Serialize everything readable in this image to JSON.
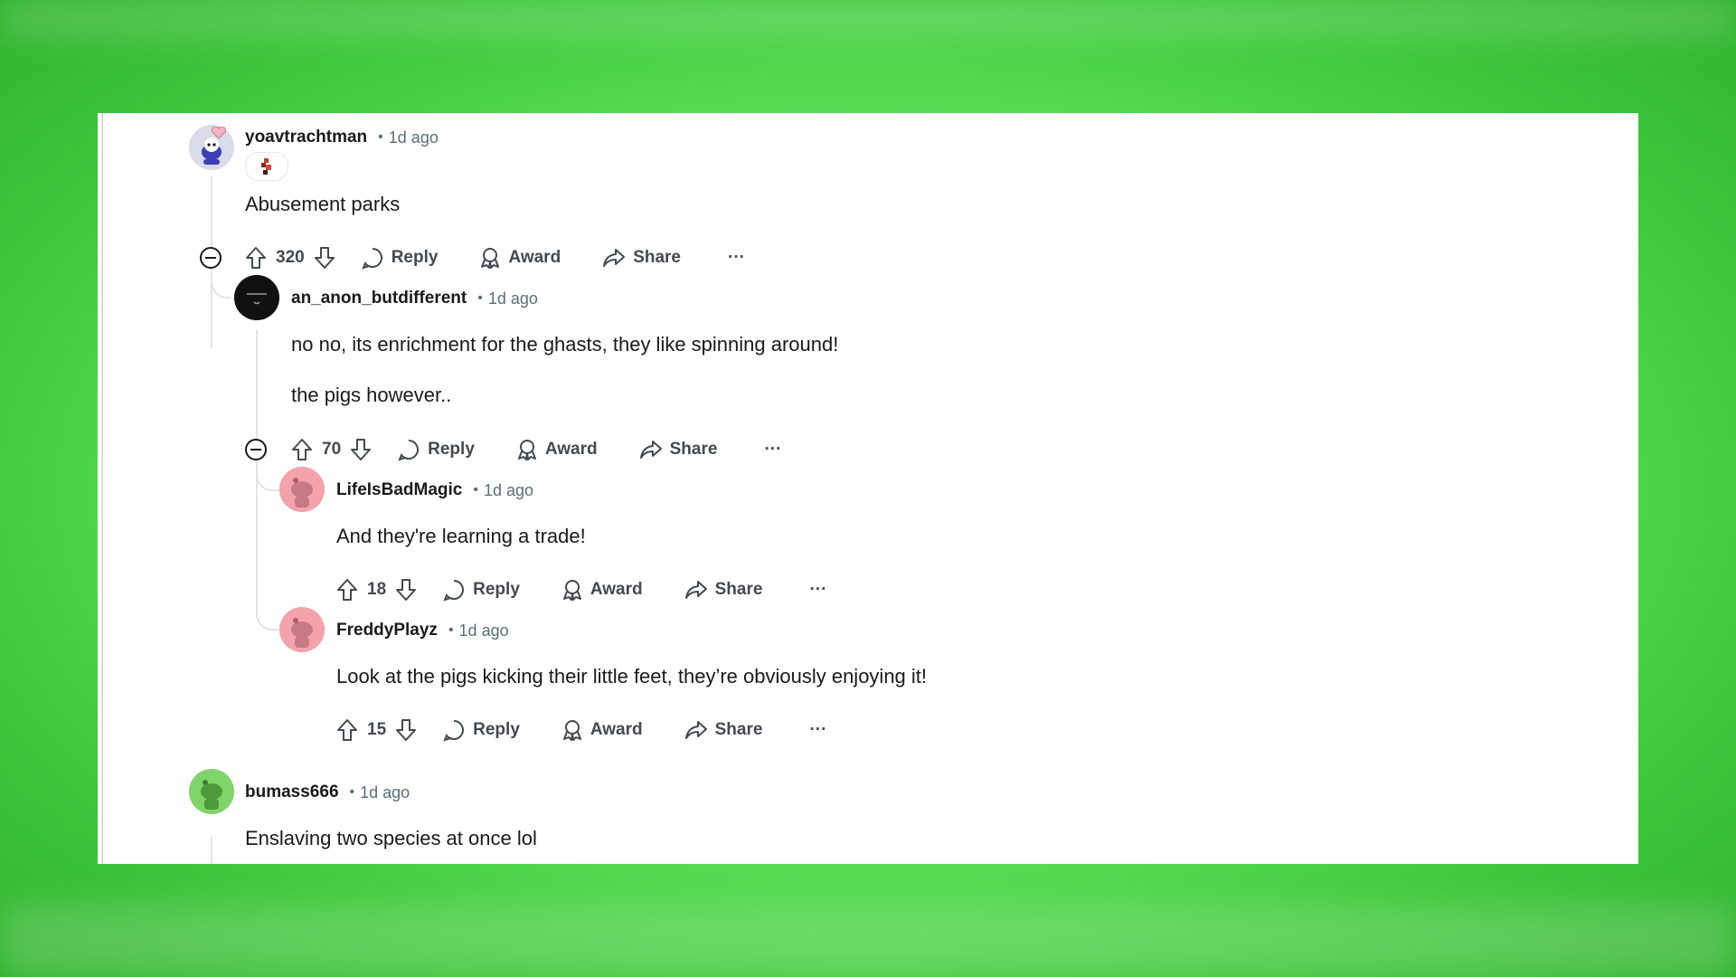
{
  "comments": [
    {
      "username": "yoavtrachtman",
      "time": "1d ago",
      "body": [
        "Abusement parks"
      ],
      "votes": "320",
      "avatar_color": "#d9dbe8"
    },
    {
      "username": "an_anon_butdifferent",
      "time": "1d ago",
      "body": [
        "no no, its enrichment for the ghasts, they like spinning around!",
        "the pigs however.."
      ],
      "votes": "70",
      "avatar_color": "#111111"
    },
    {
      "username": "LifeIsBadMagic",
      "time": "1d ago",
      "body": [
        "And they're learning a trade!"
      ],
      "votes": "18",
      "avatar_color": "#f4a3ad"
    },
    {
      "username": "FreddyPlayz",
      "time": "1d ago",
      "body": [
        "Look at the pigs kicking their little feet, they’re obviously enjoying it!"
      ],
      "votes": "15",
      "avatar_color": "#f4a3ad"
    },
    {
      "username": "bumass666",
      "time": "1d ago",
      "body": [
        "Enslaving two species at once lol"
      ],
      "avatar_color": "#7fd46a"
    }
  ],
  "actions": {
    "reply": "Reply",
    "award": "Award",
    "share": "Share",
    "more": "···"
  },
  "colors": {
    "background": "#6fe86a",
    "card": "#ffffff",
    "text": "#1a1a1b",
    "muted": "#576f76"
  }
}
